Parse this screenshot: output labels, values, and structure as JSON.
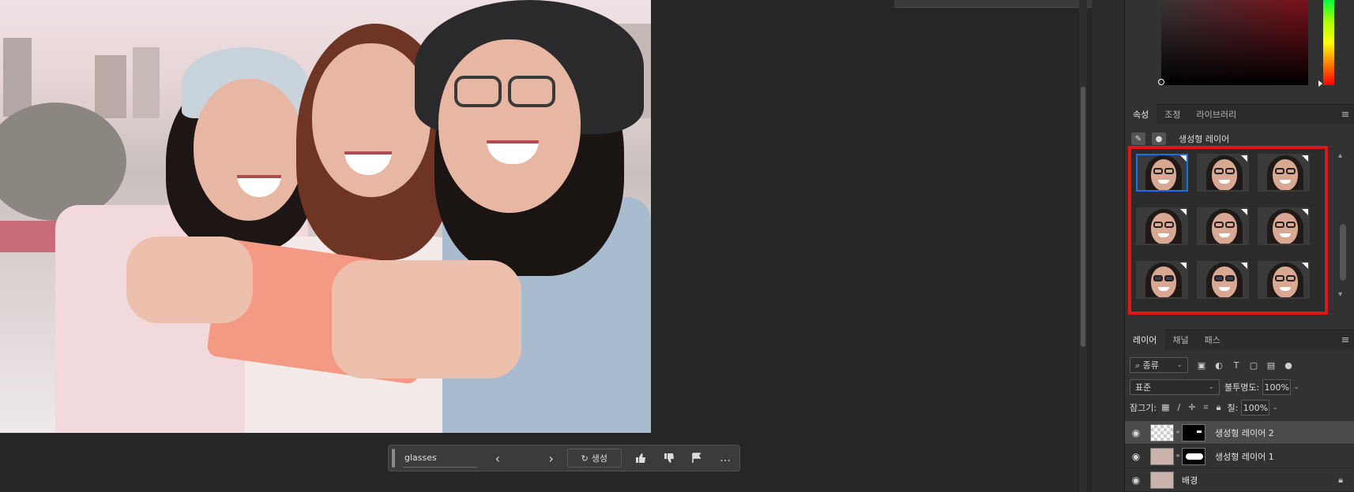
{
  "taskbar": {
    "prompt_value": "glasses",
    "prev_icon": "chevron-left-icon",
    "next_icon": "chevron-right-icon",
    "generate_label": "생성",
    "icons": [
      "thumbs-up-icon",
      "thumbs-down-icon",
      "flag-icon",
      "more-icon"
    ]
  },
  "properties_panel": {
    "tabs": [
      "속성",
      "조정",
      "라이브러리"
    ],
    "active_tab": "속성",
    "title": "생성형 레이어",
    "variation_count": 9,
    "selected_variation": 1,
    "highlight_color": "#e01717",
    "selected_color": "#1e6de6"
  },
  "layers_panel": {
    "tabs": [
      "레이어",
      "채널",
      "패스"
    ],
    "active_tab": "레이어",
    "filter_label": "종류",
    "blend_mode": "표준",
    "opacity_label": "불투명도:",
    "opacity_value": "100%",
    "lock_label": "잠그기:",
    "fill_label": "칠:",
    "fill_value": "100%",
    "layers": [
      {
        "name": "생성형 레이어 2",
        "active": true
      },
      {
        "name": "생성형 레이어 1",
        "active": false
      },
      {
        "name": "배경",
        "active": false,
        "locked": true
      }
    ]
  },
  "colors": {
    "app_bg": "#262626",
    "panel_bg": "#323232",
    "accent_red": "#e01717",
    "accent_blue": "#1e6de6"
  }
}
